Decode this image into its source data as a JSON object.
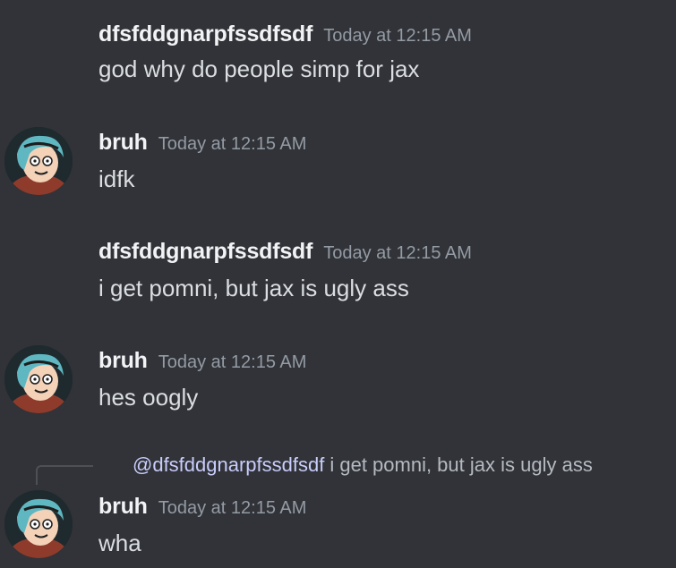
{
  "messages": [
    {
      "username": "dfsfddgnarpfssdfsdf",
      "timestamp": "Today at 12:15 AM",
      "content": "god why do people simp for jax",
      "has_avatar": false
    },
    {
      "username": "bruh",
      "timestamp": "Today at 12:15 AM",
      "content": "idfk",
      "has_avatar": true
    },
    {
      "username": "dfsfddgnarpfssdfsdf",
      "timestamp": "Today at 12:15 AM",
      "content": "i get pomni, but jax is ugly ass",
      "has_avatar": false
    },
    {
      "username": "bruh",
      "timestamp": "Today at 12:15 AM",
      "content": "hes oogly",
      "has_avatar": true
    },
    {
      "username": "bruh",
      "timestamp": "Today at 12:15 AM",
      "content": "wha",
      "has_avatar": true,
      "reply": {
        "mention": "@dfsfddgnarpfssdfsdf",
        "text": "i get pomni, but jax is ugly ass"
      }
    }
  ],
  "colors": {
    "background": "#313338",
    "username": "#f2f3f5",
    "timestamp": "#949ba4",
    "text": "#dbdee1",
    "mention": "#c9cdfb"
  }
}
